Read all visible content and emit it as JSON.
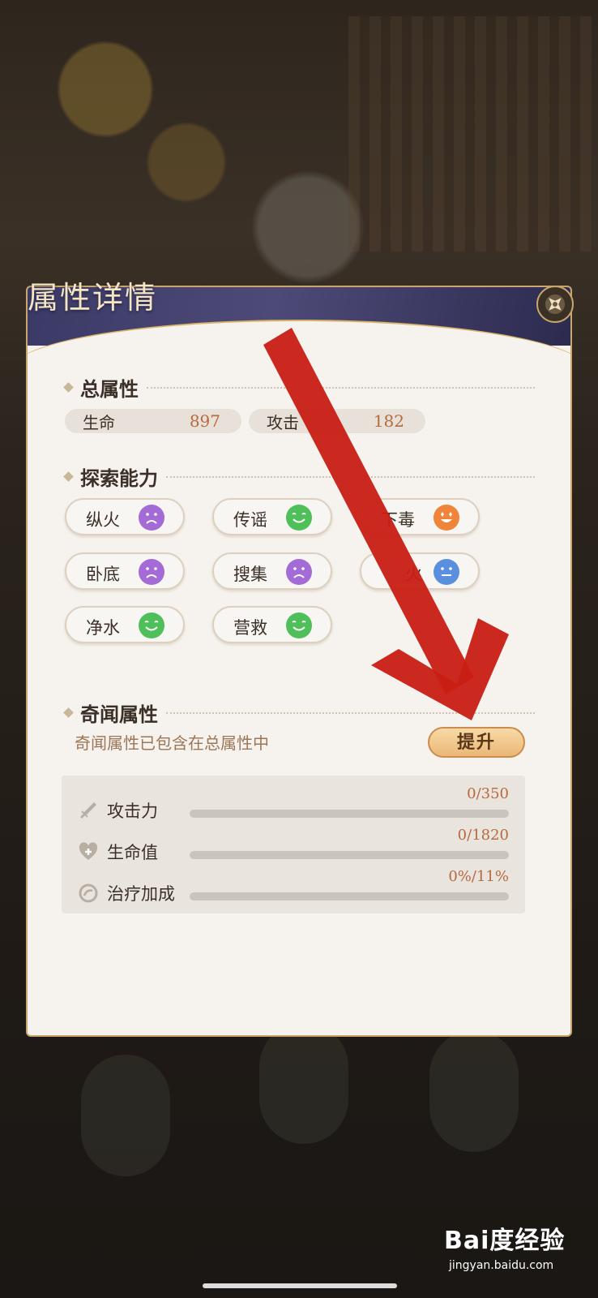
{
  "dialog": {
    "title": "属性详情"
  },
  "total": {
    "heading": "总属性",
    "stats": [
      {
        "label": "生命",
        "value": "897"
      },
      {
        "label": "攻击",
        "value": "182"
      }
    ]
  },
  "explore": {
    "heading": "探索能力",
    "abilities": [
      {
        "label": "纵火",
        "mood": "sad",
        "color": "#a46ad6"
      },
      {
        "label": "传谣",
        "mood": "happy",
        "color": "#4fbf5a"
      },
      {
        "label": "下毒",
        "mood": "excited",
        "color": "#f0843a"
      },
      {
        "label": "卧底",
        "mood": "sad",
        "color": "#a46ad6"
      },
      {
        "label": "搜集",
        "mood": "sad",
        "color": "#a46ad6"
      },
      {
        "label": "火",
        "mood": "neutral",
        "color": "#5a8fe0"
      },
      {
        "label": "净水",
        "mood": "happy",
        "color": "#4fbf5a"
      },
      {
        "label": "营救",
        "mood": "happy",
        "color": "#4fbf5a"
      }
    ]
  },
  "rumor": {
    "heading": "奇闻属性",
    "note": "奇闻属性已包含在总属性中",
    "boost_label": "提升",
    "rows": [
      {
        "icon": "sword-icon",
        "label": "攻击力",
        "value": "0/350",
        "progress": 0
      },
      {
        "icon": "heart-plus-icon",
        "label": "生命值",
        "value": "0/1820",
        "progress": 0
      },
      {
        "icon": "heal-icon",
        "label": "治疗加成",
        "value": "0%/11%",
        "progress": 0
      }
    ]
  },
  "watermark": {
    "logo": "Bai度经验",
    "site": "jingyan.baidu.com"
  },
  "colors": {
    "accent": "#b86a3c",
    "arrow": "#c81e14",
    "panel_border": "#c9a66b"
  }
}
